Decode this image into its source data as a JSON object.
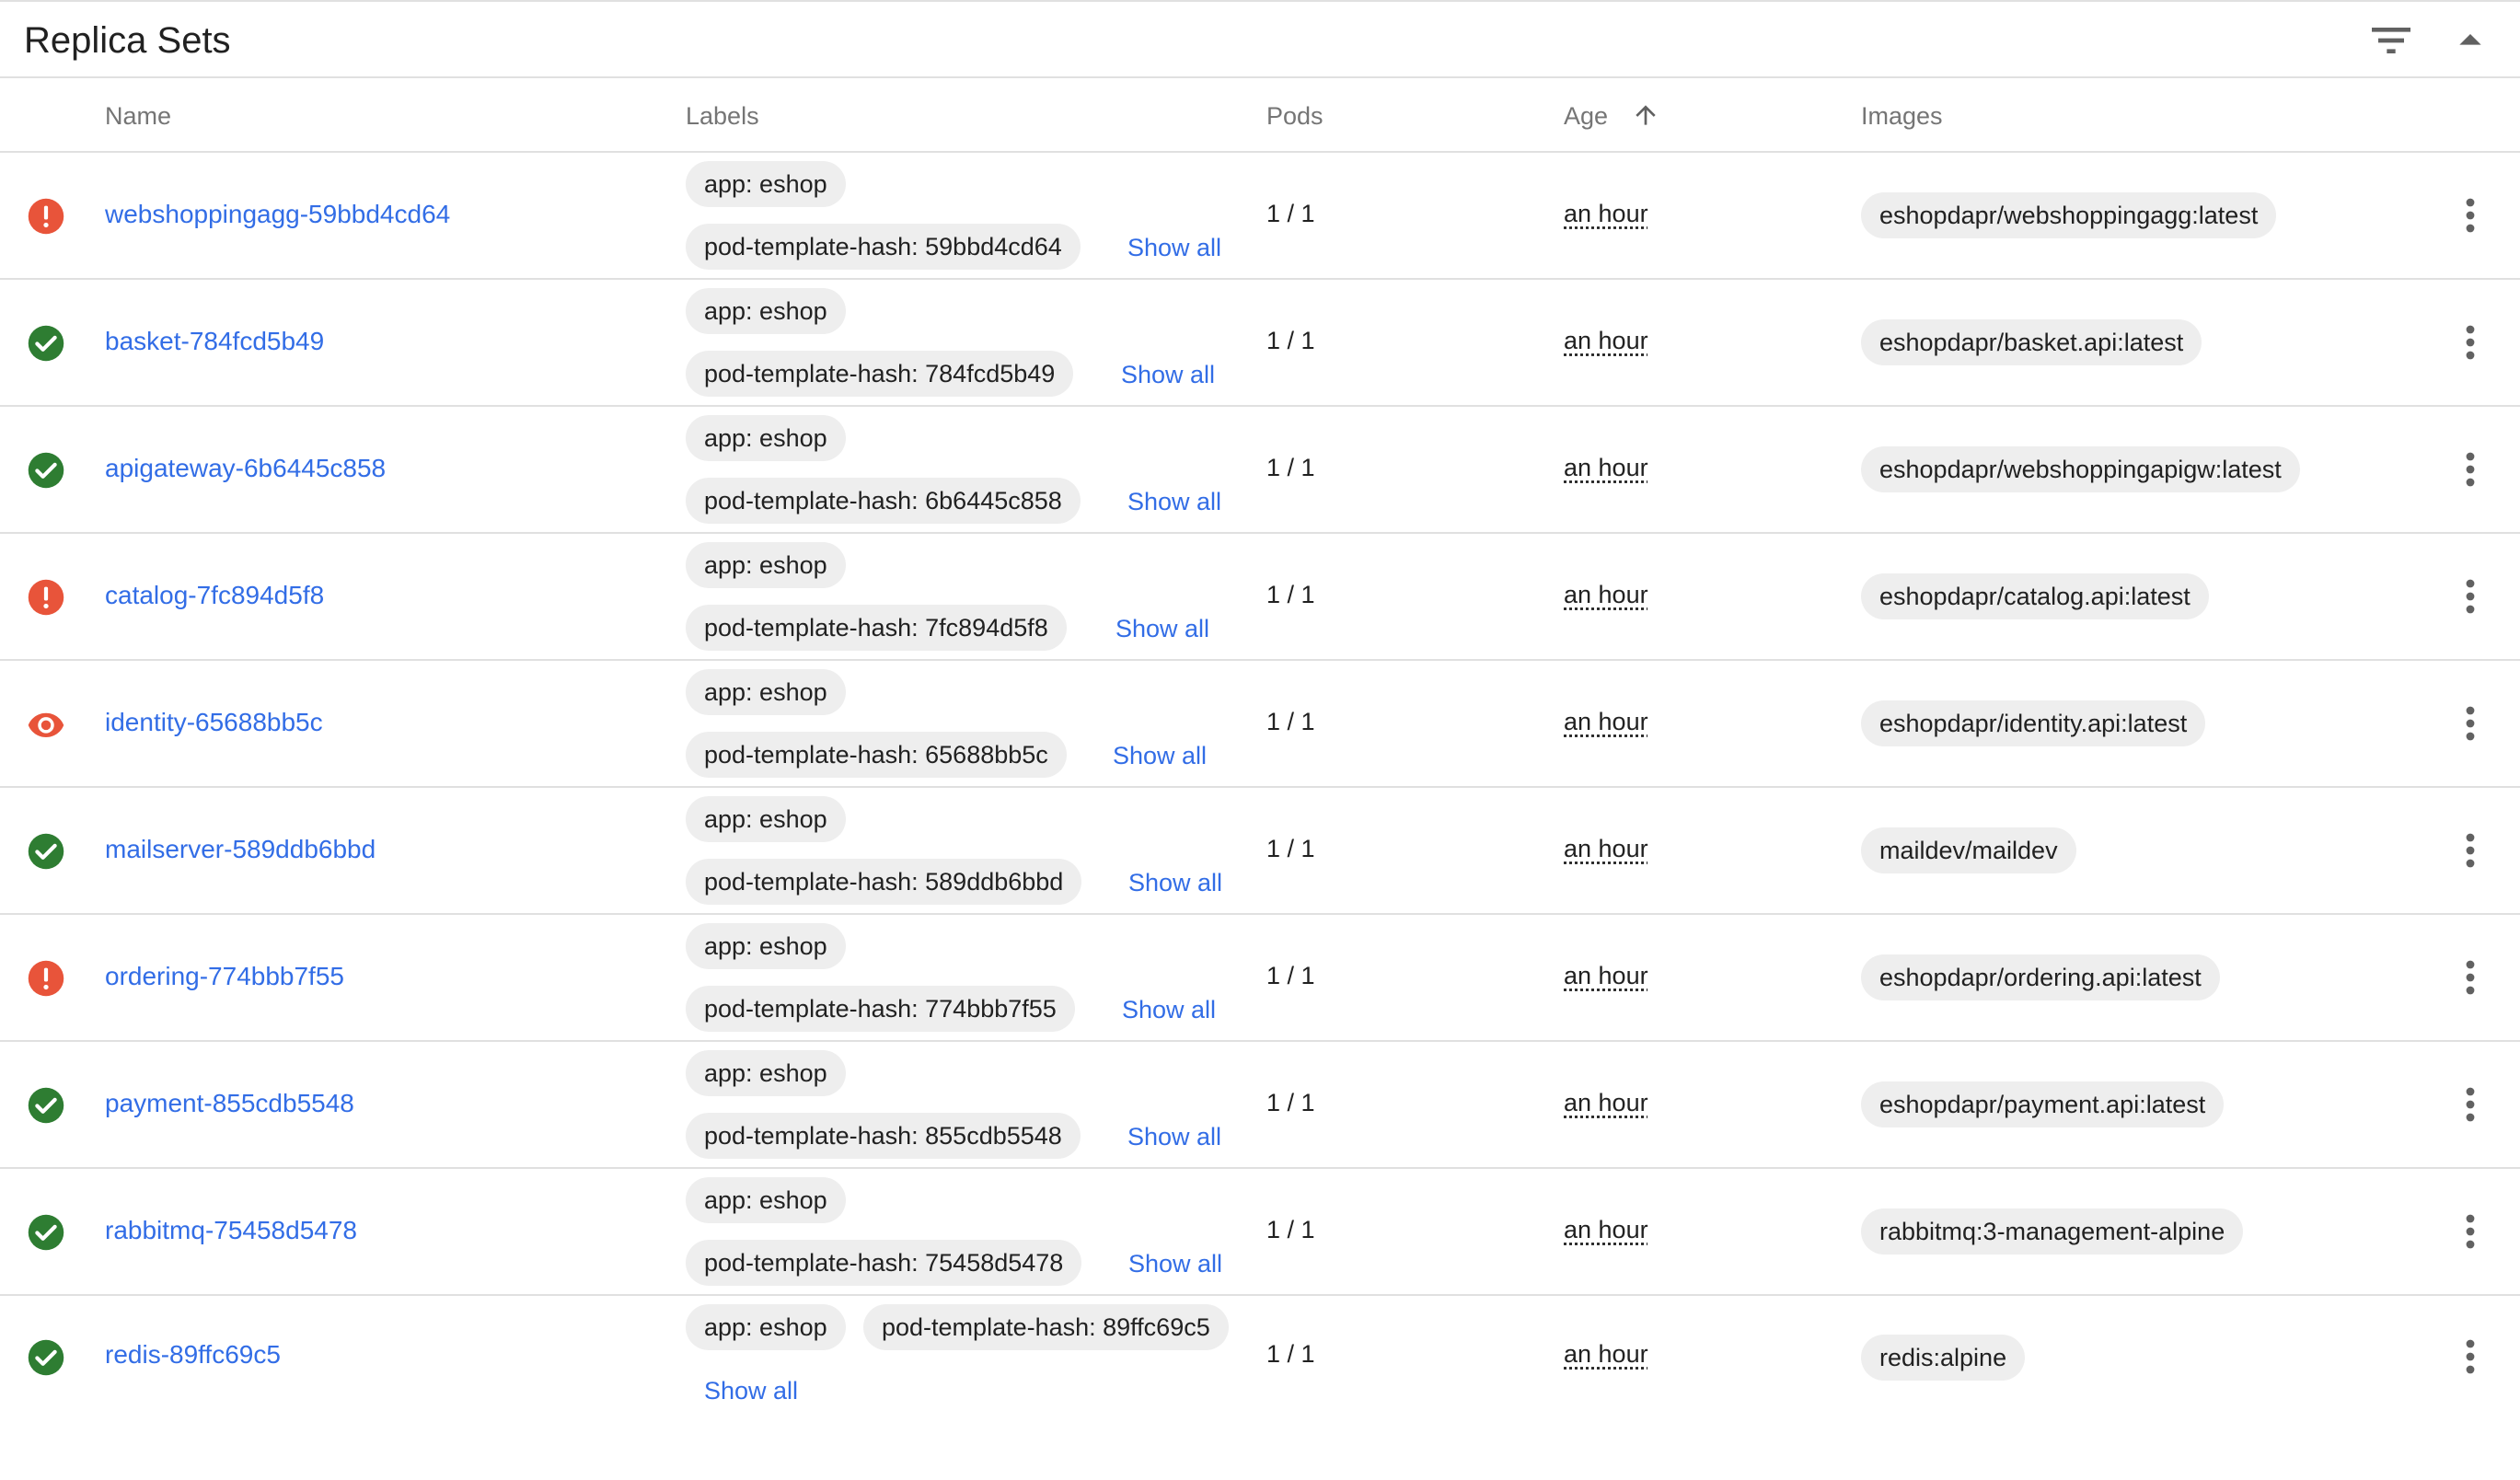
{
  "panel": {
    "title": "Replica Sets"
  },
  "header_actions": {
    "filter_icon": "filter-list-icon",
    "collapse_icon": "arrow-drop-up-icon"
  },
  "columns": {
    "name": "Name",
    "labels": "Labels",
    "pods": "Pods",
    "age": "Age",
    "images": "Images",
    "sort_icon": "arrow-upward-icon"
  },
  "colors": {
    "link": "#326de6",
    "success": "#2e7d32",
    "error": "#e8543a",
    "chip_bg": "#eeeeee",
    "border": "#e0e0e0"
  },
  "rows": [
    {
      "status": "error",
      "status_icon": "error-icon",
      "name": "webshoppingagg-59bbd4cd64",
      "label_app": "app: eshop",
      "label_hash": "pod-template-hash: 59bbd4cd64",
      "show_all": "Show all",
      "pods": "1 / 1",
      "age": "an hour",
      "image": "eshopdapr/webshoppingagg:latest"
    },
    {
      "status": "success",
      "status_icon": "check-circle-icon",
      "name": "basket-784fcd5b49",
      "label_app": "app: eshop",
      "label_hash": "pod-template-hash: 784fcd5b49",
      "show_all": "Show all",
      "pods": "1 / 1",
      "age": "an hour",
      "image": "eshopdapr/basket.api:latest"
    },
    {
      "status": "success",
      "status_icon": "check-circle-icon",
      "name": "apigateway-6b6445c858",
      "label_app": "app: eshop",
      "label_hash": "pod-template-hash: 6b6445c858",
      "show_all": "Show all",
      "pods": "1 / 1",
      "age": "an hour",
      "image": "eshopdapr/webshoppingapigw:latest"
    },
    {
      "status": "error",
      "status_icon": "error-icon",
      "name": "catalog-7fc894d5f8",
      "label_app": "app: eshop",
      "label_hash": "pod-template-hash: 7fc894d5f8",
      "show_all": "Show all",
      "pods": "1 / 1",
      "age": "an hour",
      "image": "eshopdapr/catalog.api:latest"
    },
    {
      "status": "pending",
      "status_icon": "eye-icon",
      "name": "identity-65688bb5c",
      "label_app": "app: eshop",
      "label_hash": "pod-template-hash: 65688bb5c",
      "show_all": "Show all",
      "pods": "1 / 1",
      "age": "an hour",
      "image": "eshopdapr/identity.api:latest"
    },
    {
      "status": "success",
      "status_icon": "check-circle-icon",
      "name": "mailserver-589ddb6bbd",
      "label_app": "app: eshop",
      "label_hash": "pod-template-hash: 589ddb6bbd",
      "show_all": "Show all",
      "pods": "1 / 1",
      "age": "an hour",
      "image": "maildev/maildev"
    },
    {
      "status": "error",
      "status_icon": "error-icon",
      "name": "ordering-774bbb7f55",
      "label_app": "app: eshop",
      "label_hash": "pod-template-hash: 774bbb7f55",
      "show_all": "Show all",
      "pods": "1 / 1",
      "age": "an hour",
      "image": "eshopdapr/ordering.api:latest"
    },
    {
      "status": "success",
      "status_icon": "check-circle-icon",
      "name": "payment-855cdb5548",
      "label_app": "app: eshop",
      "label_hash": "pod-template-hash: 855cdb5548",
      "show_all": "Show all",
      "pods": "1 / 1",
      "age": "an hour",
      "image": "eshopdapr/payment.api:latest"
    },
    {
      "status": "success",
      "status_icon": "check-circle-icon",
      "name": "rabbitmq-75458d5478",
      "label_app": "app: eshop",
      "label_hash": "pod-template-hash: 75458d5478",
      "show_all": "Show all",
      "pods": "1 / 1",
      "age": "an hour",
      "image": "rabbitmq:3-management-alpine"
    },
    {
      "status": "success",
      "status_icon": "check-circle-icon",
      "name": "redis-89ffc69c5",
      "label_app": "app: eshop",
      "label_hash": "pod-template-hash: 89ffc69c5",
      "show_all": "Show all",
      "pods": "1 / 1",
      "age": "an hour",
      "image": "redis:alpine"
    }
  ]
}
